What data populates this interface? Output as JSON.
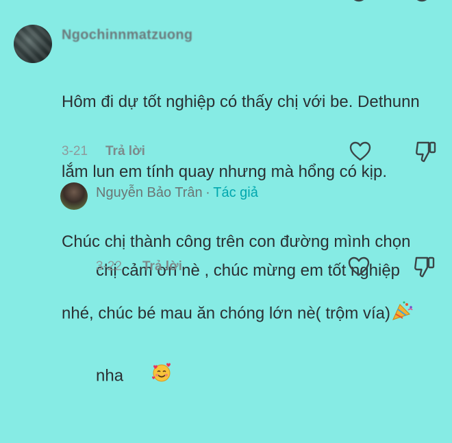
{
  "comments": [
    {
      "username": "Ngochinnmatzuong",
      "text_lines": [
        "Hôm đi dự tốt nghiệp có thấy chị với be. Dethunn",
        "lắm lun em tính quay nhưng mà hổng có kịp.",
        "Chúc chị thành công trên con đường mình chọn",
        "nhé, chúc bé mau ăn chóng lớn nè( trộm vía)"
      ],
      "trailing_emoji": "party-popper",
      "date": "3-21",
      "reply_label": "Trả lời"
    }
  ],
  "reply": {
    "name": "Nguyễn Bảo Trân",
    "separator": "·",
    "author_tag": "Tác giả",
    "text_lines": [
      "chị cảm ơn nè , chúc mừng em tốt nghiệp",
      "nha"
    ],
    "trailing_emoji": "smiling-face-with-hearts",
    "date": "3-22",
    "reply_label": "Trả lời"
  },
  "colors": {
    "background": "#86ebe4",
    "author_accent": "#00a7ae",
    "icon_stroke": "#3b4547"
  }
}
